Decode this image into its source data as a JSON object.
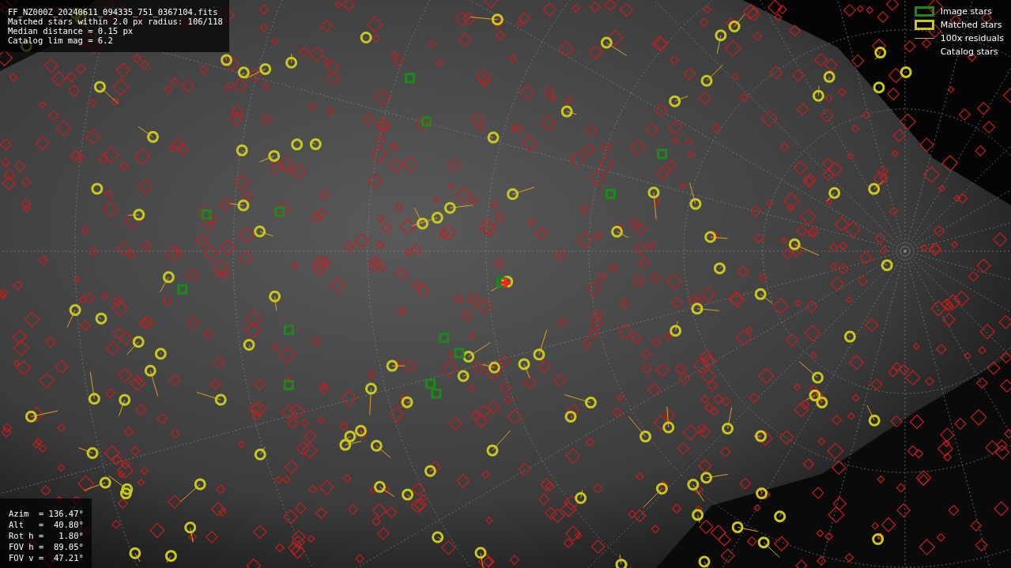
{
  "header_info": {
    "lines": [
      "FF_NZ000Z_20240611_094335_751_0367104.fits",
      "Matched stars within 2.0 px radius: 106/118",
      "Median distance = 0.15 px",
      "Catalog lim mag = 6.2"
    ]
  },
  "legend": {
    "items": [
      {
        "kind": "box",
        "label": "Image stars",
        "color": "#1a8a1a"
      },
      {
        "kind": "box",
        "label": "Matched stars",
        "color": "#c8c81e"
      },
      {
        "kind": "line",
        "label": "100x residuals",
        "color": "#e6a01e"
      },
      {
        "kind": "none",
        "label": "Catalog stars"
      }
    ]
  },
  "pointing_info": {
    "lines": [
      "Azim  = 136.47°",
      "Alt   =  40.80°",
      "Rot h =   1.80°",
      "FOV h =  89.05°",
      "FOV v =  47.21°"
    ]
  }
}
